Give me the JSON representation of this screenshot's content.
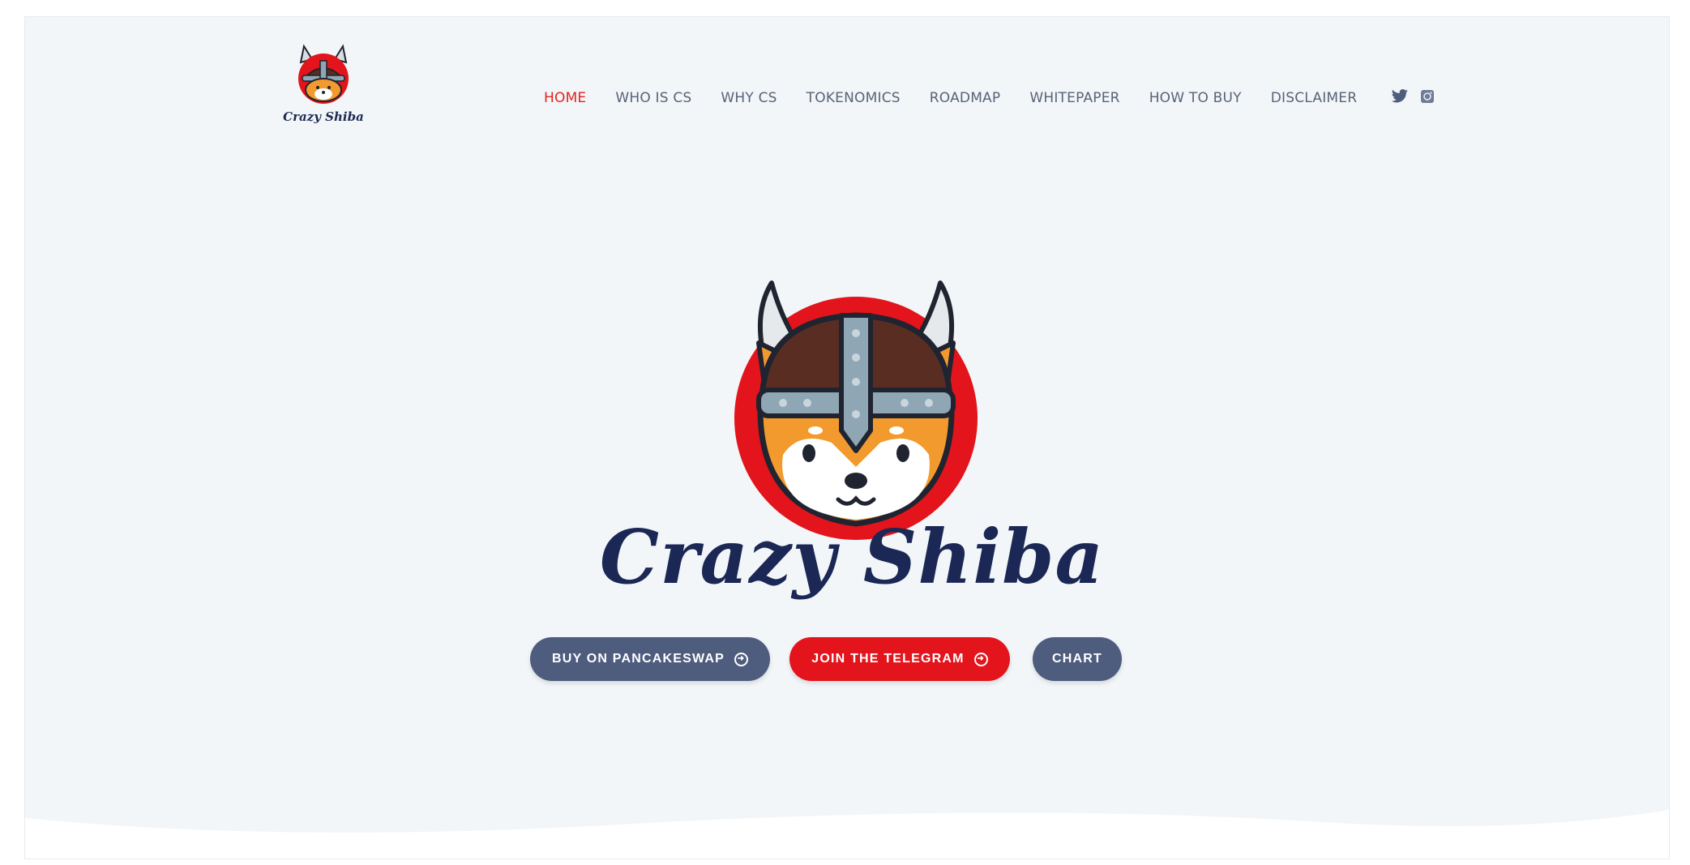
{
  "brand": {
    "name": "Crazy Shiba",
    "logo_text": "Crazy Shiba"
  },
  "nav": {
    "items": [
      {
        "label": "HOME",
        "active": true
      },
      {
        "label": "WHO IS CS",
        "active": false
      },
      {
        "label": "WHY CS",
        "active": false
      },
      {
        "label": "TOKENOMICS",
        "active": false
      },
      {
        "label": "ROADMAP",
        "active": false
      },
      {
        "label": "WHITEPAPER",
        "active": false
      },
      {
        "label": "HOW TO BUY",
        "active": false
      },
      {
        "label": "DISCLAIMER",
        "active": false
      }
    ],
    "social_icons": [
      "twitter-icon",
      "instagram-icon"
    ]
  },
  "hero": {
    "title": "Crazy Shiba",
    "buttons": {
      "pancakeswap": "BUY ON PANCAKESWAP",
      "telegram": "JOIN THE TELEGRAM",
      "chart": "CHART"
    }
  },
  "colors": {
    "accent": "#e3231f",
    "navy": "#1b2754",
    "button_slate": "#4e5c7e",
    "background": "#f2f6f9"
  }
}
